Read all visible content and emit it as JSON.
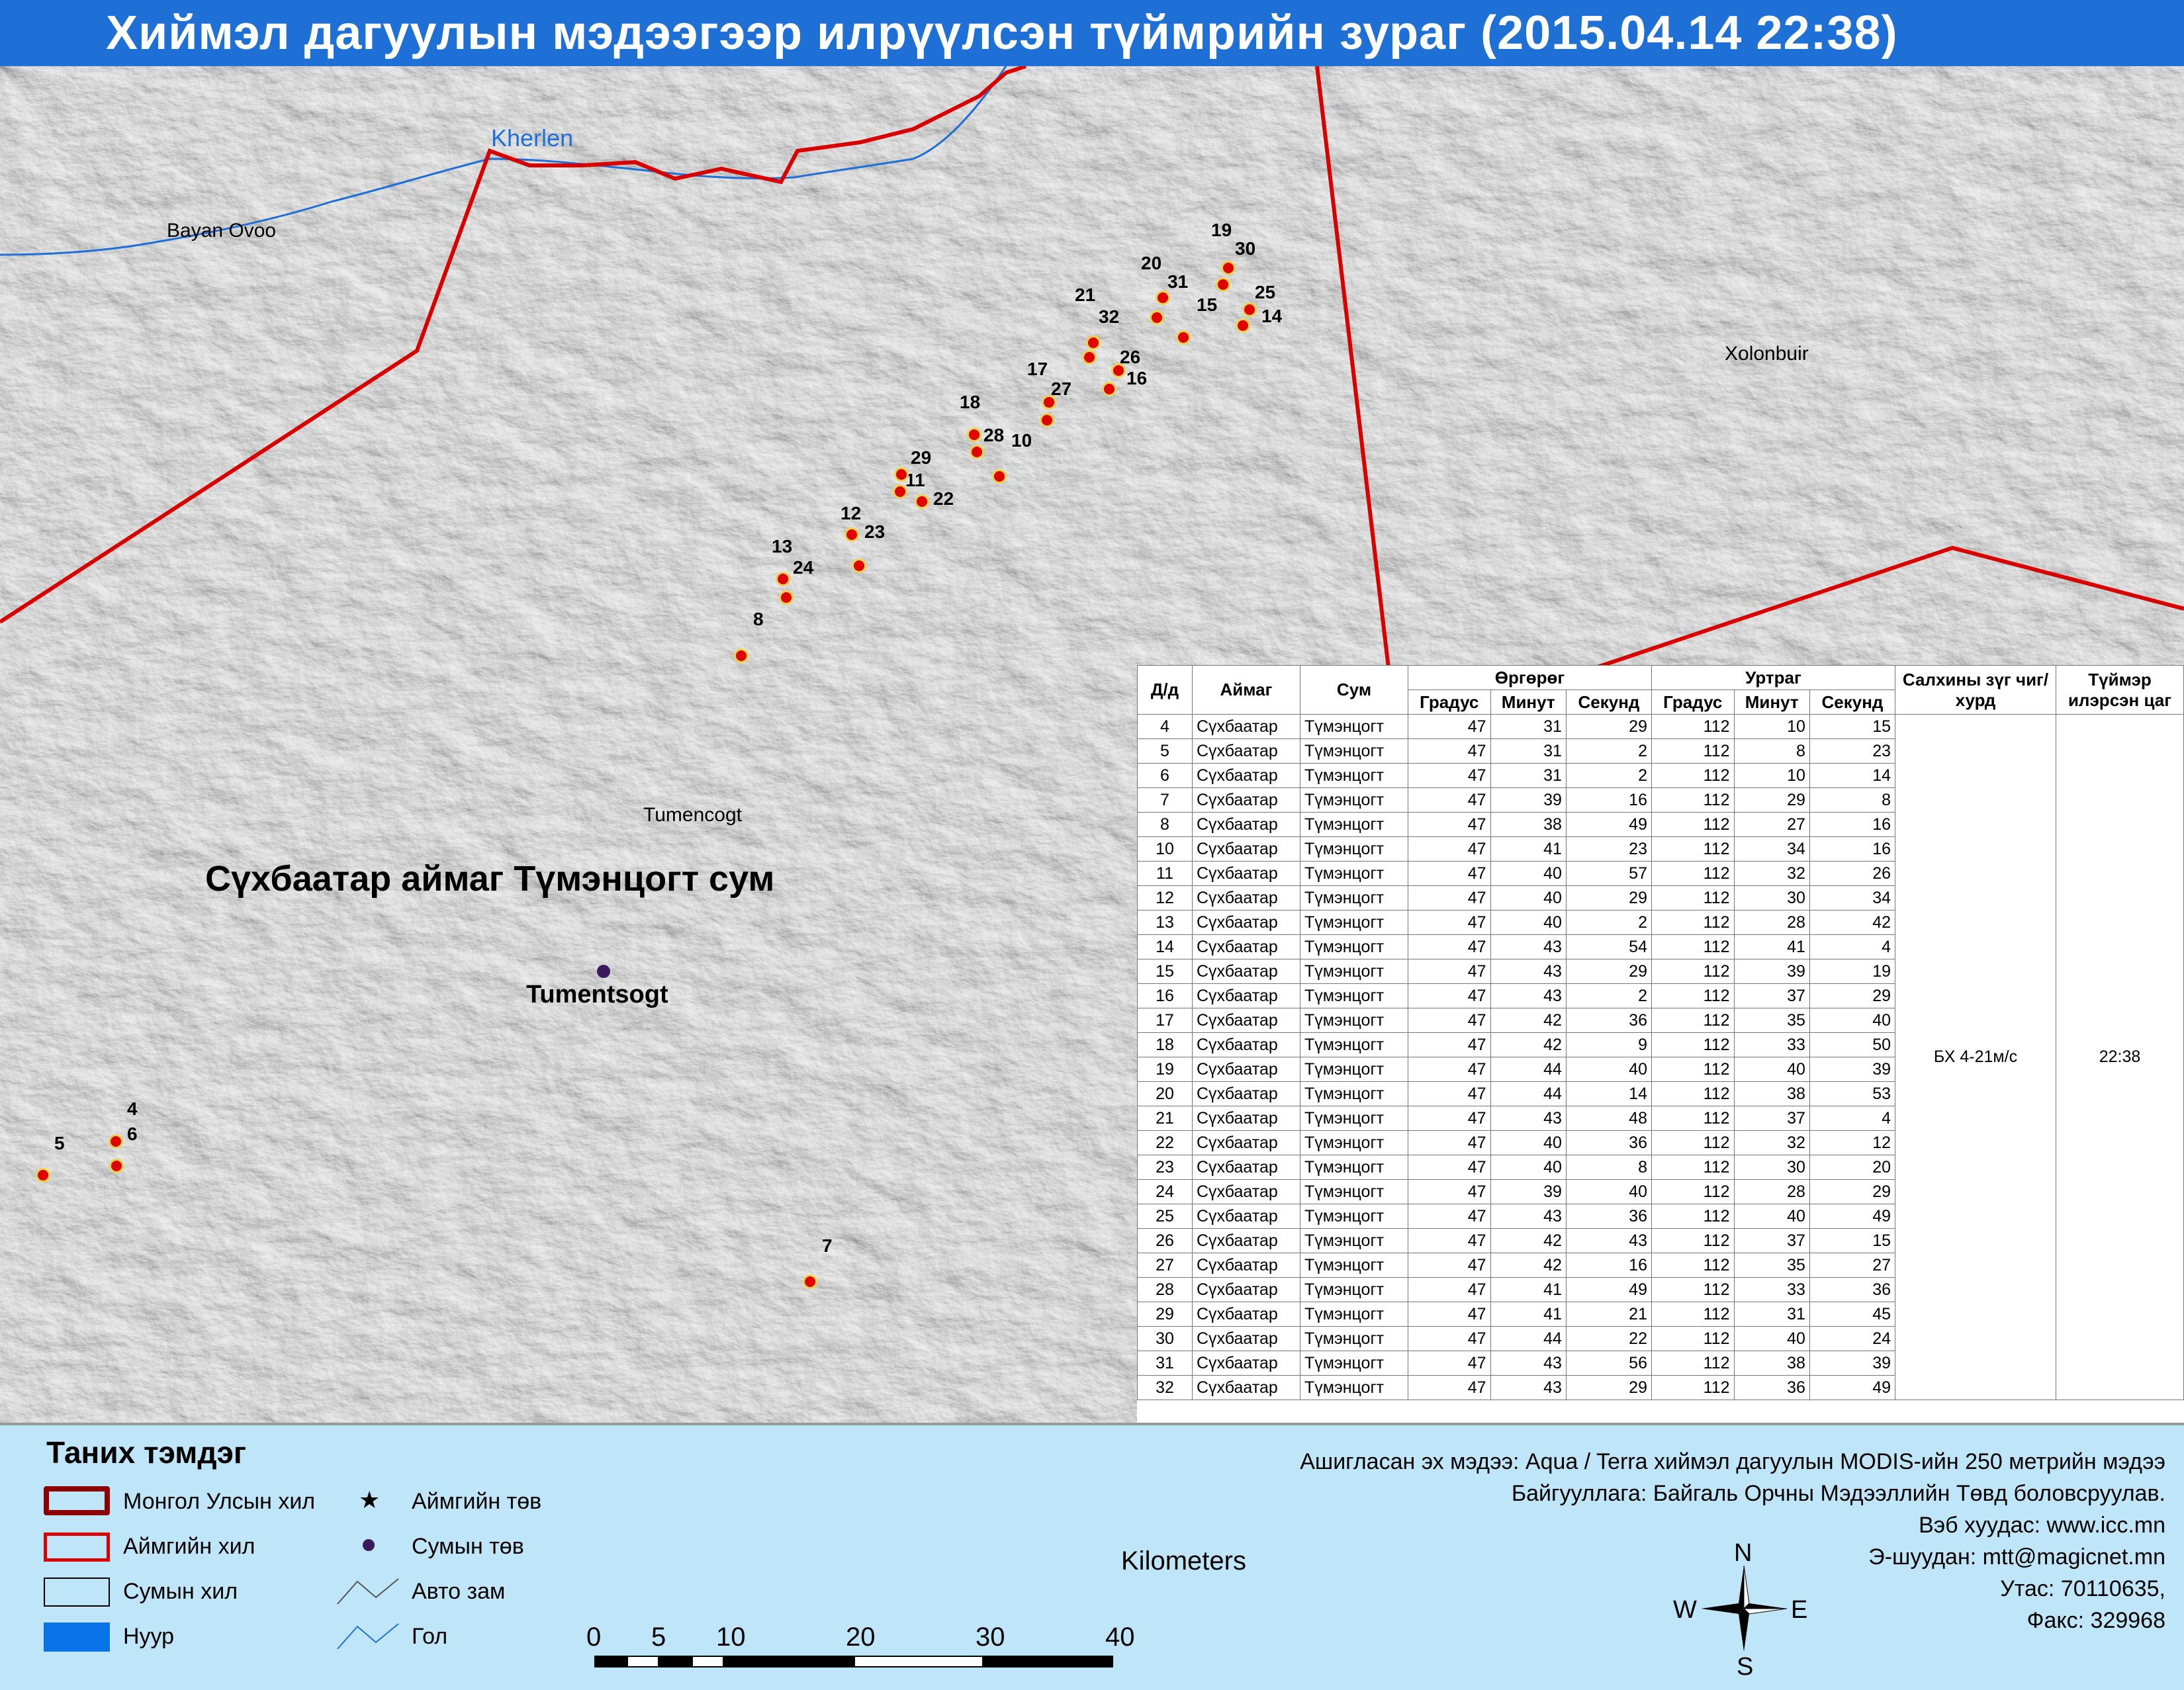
{
  "title": "Хиймэл дагуулын мэдээгээр илрүүлсэн түймрийн зураг  (2015.04.14 22:38)",
  "map": {
    "places": {
      "kherlen": "Kherlen",
      "bayan_ovoo": "Bayan Ovoo",
      "xolonbuir": "Xolonbuir",
      "tumencogt": "Tumencogt",
      "region": "Сүхбаатар аймаг Түмэнцогт сум",
      "tumentsogt": "Tumentsogt"
    },
    "fires": [
      {
        "id": "4"
      },
      {
        "id": "5"
      },
      {
        "id": "6"
      },
      {
        "id": "7"
      },
      {
        "id": "8"
      },
      {
        "id": "10"
      },
      {
        "id": "11"
      },
      {
        "id": "12"
      },
      {
        "id": "13"
      },
      {
        "id": "14"
      },
      {
        "id": "15"
      },
      {
        "id": "16"
      },
      {
        "id": "17"
      },
      {
        "id": "18"
      },
      {
        "id": "19"
      },
      {
        "id": "20"
      },
      {
        "id": "21"
      },
      {
        "id": "22"
      },
      {
        "id": "23"
      },
      {
        "id": "24"
      },
      {
        "id": "25"
      },
      {
        "id": "26"
      },
      {
        "id": "27"
      },
      {
        "id": "28"
      },
      {
        "id": "29"
      },
      {
        "id": "30"
      },
      {
        "id": "31"
      },
      {
        "id": "32"
      }
    ],
    "colors": {
      "border": "#d90000",
      "river": "#1e6fd6",
      "fire": "#e00000",
      "fire_outline": "#f2d24a",
      "sum_center": "#3a1a5a"
    }
  },
  "table": {
    "headers": {
      "dd": "Д/д",
      "aimag": "Аймаг",
      "sum": "Сум",
      "lat": "Өргөрөг",
      "lon": "Уртраг",
      "deg": "Градус",
      "min": "Минут",
      "sec": "Секунд",
      "wind": "Салхины зүг чиг/хурд",
      "time": "Түймэр илэрсэн цаг"
    },
    "wind_value": "БХ 4-21м/с",
    "time_value": "22:38",
    "rows": [
      [
        "4",
        "Сүхбаатар",
        "Түмэнцогт",
        "47",
        "31",
        "29",
        "112",
        "10",
        "15"
      ],
      [
        "5",
        "Сүхбаатар",
        "Түмэнцогт",
        "47",
        "31",
        "2",
        "112",
        "8",
        "23"
      ],
      [
        "6",
        "Сүхбаатар",
        "Түмэнцогт",
        "47",
        "31",
        "2",
        "112",
        "10",
        "14"
      ],
      [
        "7",
        "Сүхбаатар",
        "Түмэнцогт",
        "47",
        "39",
        "16",
        "112",
        "29",
        "8"
      ],
      [
        "8",
        "Сүхбаатар",
        "Түмэнцогт",
        "47",
        "38",
        "49",
        "112",
        "27",
        "16"
      ],
      [
        "10",
        "Сүхбаатар",
        "Түмэнцогт",
        "47",
        "41",
        "23",
        "112",
        "34",
        "16"
      ],
      [
        "11",
        "Сүхбаатар",
        "Түмэнцогт",
        "47",
        "40",
        "57",
        "112",
        "32",
        "26"
      ],
      [
        "12",
        "Сүхбаатар",
        "Түмэнцогт",
        "47",
        "40",
        "29",
        "112",
        "30",
        "34"
      ],
      [
        "13",
        "Сүхбаатар",
        "Түмэнцогт",
        "47",
        "40",
        "2",
        "112",
        "28",
        "42"
      ],
      [
        "14",
        "Сүхбаатар",
        "Түмэнцогт",
        "47",
        "43",
        "54",
        "112",
        "41",
        "4"
      ],
      [
        "15",
        "Сүхбаатар",
        "Түмэнцогт",
        "47",
        "43",
        "29",
        "112",
        "39",
        "19"
      ],
      [
        "16",
        "Сүхбаатар",
        "Түмэнцогт",
        "47",
        "43",
        "2",
        "112",
        "37",
        "29"
      ],
      [
        "17",
        "Сүхбаатар",
        "Түмэнцогт",
        "47",
        "42",
        "36",
        "112",
        "35",
        "40"
      ],
      [
        "18",
        "Сүхбаатар",
        "Түмэнцогт",
        "47",
        "42",
        "9",
        "112",
        "33",
        "50"
      ],
      [
        "19",
        "Сүхбаатар",
        "Түмэнцогт",
        "47",
        "44",
        "40",
        "112",
        "40",
        "39"
      ],
      [
        "20",
        "Сүхбаатар",
        "Түмэнцогт",
        "47",
        "44",
        "14",
        "112",
        "38",
        "53"
      ],
      [
        "21",
        "Сүхбаатар",
        "Түмэнцогт",
        "47",
        "43",
        "48",
        "112",
        "37",
        "4"
      ],
      [
        "22",
        "Сүхбаатар",
        "Түмэнцогт",
        "47",
        "40",
        "36",
        "112",
        "32",
        "12"
      ],
      [
        "23",
        "Сүхбаатар",
        "Түмэнцогт",
        "47",
        "40",
        "8",
        "112",
        "30",
        "20"
      ],
      [
        "24",
        "Сүхбаатар",
        "Түмэнцогт",
        "47",
        "39",
        "40",
        "112",
        "28",
        "29"
      ],
      [
        "25",
        "Сүхбаатар",
        "Түмэнцогт",
        "47",
        "43",
        "36",
        "112",
        "40",
        "49"
      ],
      [
        "26",
        "Сүхбаатар",
        "Түмэнцогт",
        "47",
        "42",
        "43",
        "112",
        "37",
        "15"
      ],
      [
        "27",
        "Сүхбаатар",
        "Түмэнцогт",
        "47",
        "42",
        "16",
        "112",
        "35",
        "27"
      ],
      [
        "28",
        "Сүхбаатар",
        "Түмэнцогт",
        "47",
        "41",
        "49",
        "112",
        "33",
        "36"
      ],
      [
        "29",
        "Сүхбаатар",
        "Түмэнцогт",
        "47",
        "41",
        "21",
        "112",
        "31",
        "45"
      ],
      [
        "30",
        "Сүхбаатар",
        "Түмэнцогт",
        "47",
        "44",
        "22",
        "112",
        "40",
        "24"
      ],
      [
        "31",
        "Сүхбаатар",
        "Түмэнцогт",
        "47",
        "43",
        "56",
        "112",
        "38",
        "39"
      ],
      [
        "32",
        "Сүхбаатар",
        "Түмэнцогт",
        "47",
        "43",
        "29",
        "112",
        "36",
        "49"
      ]
    ]
  },
  "legend": {
    "title": "Таних тэмдэг",
    "items": {
      "country_border": "Монгол Улсын хил",
      "aimag_border": "Аймгийн хил",
      "sum_border": "Сумын хил",
      "lake": "Нуур",
      "aimag_center": "Аймгийн төв",
      "sum_center": "Сумын төв",
      "road": "Авто зам",
      "river": "Гол"
    }
  },
  "scale": {
    "ticks": [
      "0",
      "5",
      "10",
      "20",
      "30",
      "40"
    ],
    "unit": "Kilometers"
  },
  "compass": {
    "n": "N",
    "s": "S",
    "e": "E",
    "w": "W"
  },
  "credits": {
    "line1": "Ашигласан эх мэдээ: Aqua / Terra хиймэл дагуулын MODIS-ийн 250 метрийн мэдээ",
    "line2": "Байгууллага: Байгаль Орчны Мэдээллийн Төвд боловсруулав.",
    "line3": "Вэб хуудас: www.icc.mn",
    "line4": "Э-шуудан: mtt@magicnet.mn",
    "line5": "Утас: 70110635,",
    "line6": "Факс: 329968"
  }
}
